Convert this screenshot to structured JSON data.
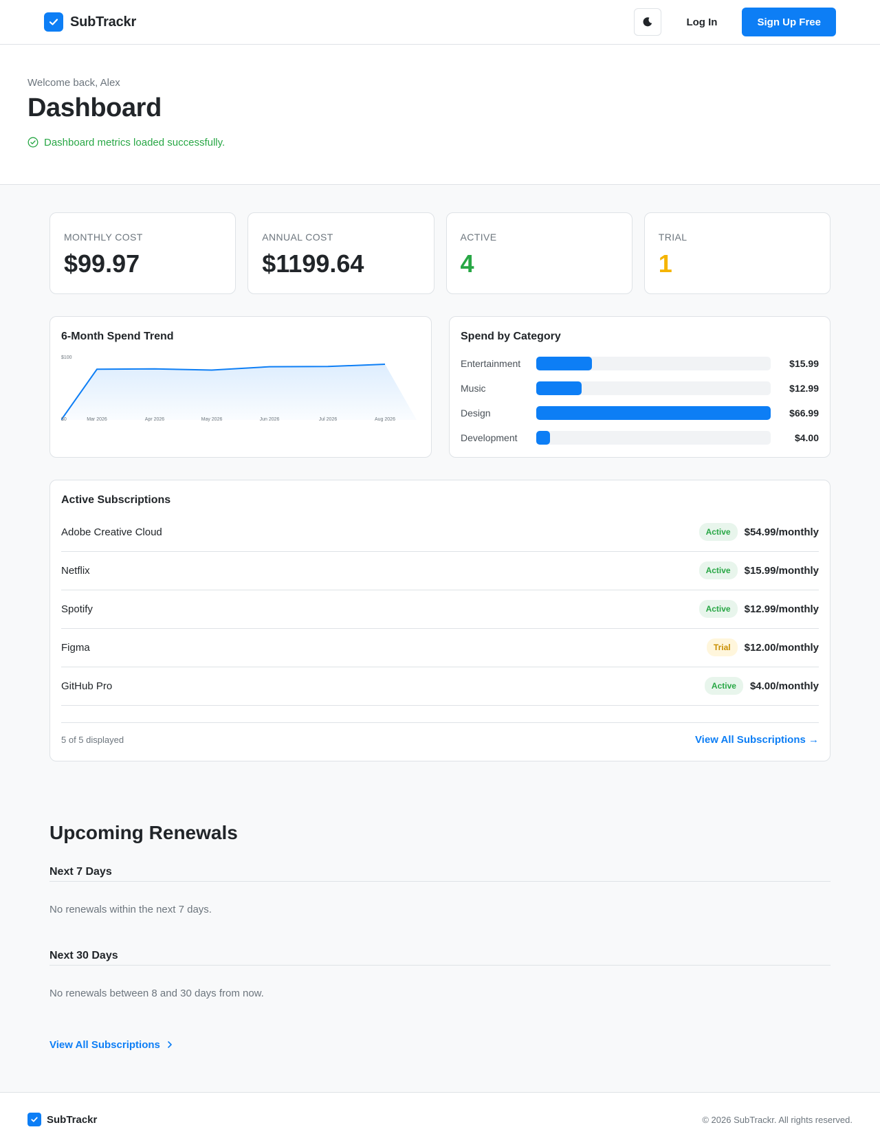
{
  "header": {
    "brand": "SubTrackr",
    "login_label": "Log In",
    "signup_label": "Sign Up Free"
  },
  "hero": {
    "welcome": "Welcome back, Alex",
    "title": "Dashboard",
    "status": "Dashboard metrics loaded successfully."
  },
  "stats": [
    {
      "label": "Monthly Cost",
      "value": "$99.97"
    },
    {
      "label": "Annual Cost",
      "value": "$1199.64"
    },
    {
      "label": "Active",
      "value": "4"
    },
    {
      "label": "Trial",
      "value": "1"
    }
  ],
  "trend": {
    "title": "6-Month Spend Trend"
  },
  "chart_data": {
    "type": "area",
    "title": "6-Month Spend Trend",
    "x": [
      "Mar 2026",
      "Apr 2026",
      "May 2026",
      "Jun 2026",
      "Jul 2026",
      "Aug 2026"
    ],
    "y_tick_labels": [
      "$0",
      "$100"
    ],
    "ylim": [
      0,
      100
    ],
    "series": [
      {
        "values": [
          0,
          82.8,
          83.4,
          81.4,
          86.9,
          87.3,
          91.0,
          0
        ]
      }
    ],
    "grid": false,
    "accent": "#0d7ef5"
  },
  "categories": {
    "title": "Spend by Category",
    "items": [
      {
        "name": "Entertainment",
        "amount": "$15.99",
        "value": 15.99
      },
      {
        "name": "Music",
        "amount": "$12.99",
        "value": 12.99
      },
      {
        "name": "Design",
        "amount": "$66.99",
        "value": 66.99
      },
      {
        "name": "Development",
        "amount": "$4.00",
        "value": 4.0
      }
    ]
  },
  "subscriptions": {
    "title": "Active Subscriptions",
    "items": [
      {
        "name": "Adobe Creative Cloud",
        "status": "Active",
        "price": "$54.99/monthly"
      },
      {
        "name": "Netflix",
        "status": "Active",
        "price": "$15.99/monthly"
      },
      {
        "name": "Spotify",
        "status": "Active",
        "price": "$12.99/monthly"
      },
      {
        "name": "Figma",
        "status": "Trial",
        "price": "$12.00/monthly"
      },
      {
        "name": "GitHub Pro",
        "status": "Active",
        "price": "$4.00/monthly"
      }
    ],
    "shown_count": "5 of 5 displayed",
    "view_all": "View All Subscriptions →"
  },
  "renewals": {
    "title": "Upcoming Renewals",
    "week_heading": "Next 7 Days",
    "week_empty": "No renewals within the next 7 days.",
    "month_heading": "Next 30 Days",
    "month_empty": "No renewals between 8 and 30 days from now.",
    "view_all": "View All Subscriptions"
  },
  "footer": {
    "brand": "SubTrackr",
    "copyright": "© 2026 SubTrackr. All rights reserved."
  },
  "colors": {
    "accent": "#0d7ef5",
    "success": "#28a745",
    "warning": "#f5b400"
  },
  "icons": {
    "logo": "check-icon",
    "theme_toggle": "moon-icon",
    "status": "check-circle-icon",
    "link_arrow": "chevron-right-icon"
  }
}
